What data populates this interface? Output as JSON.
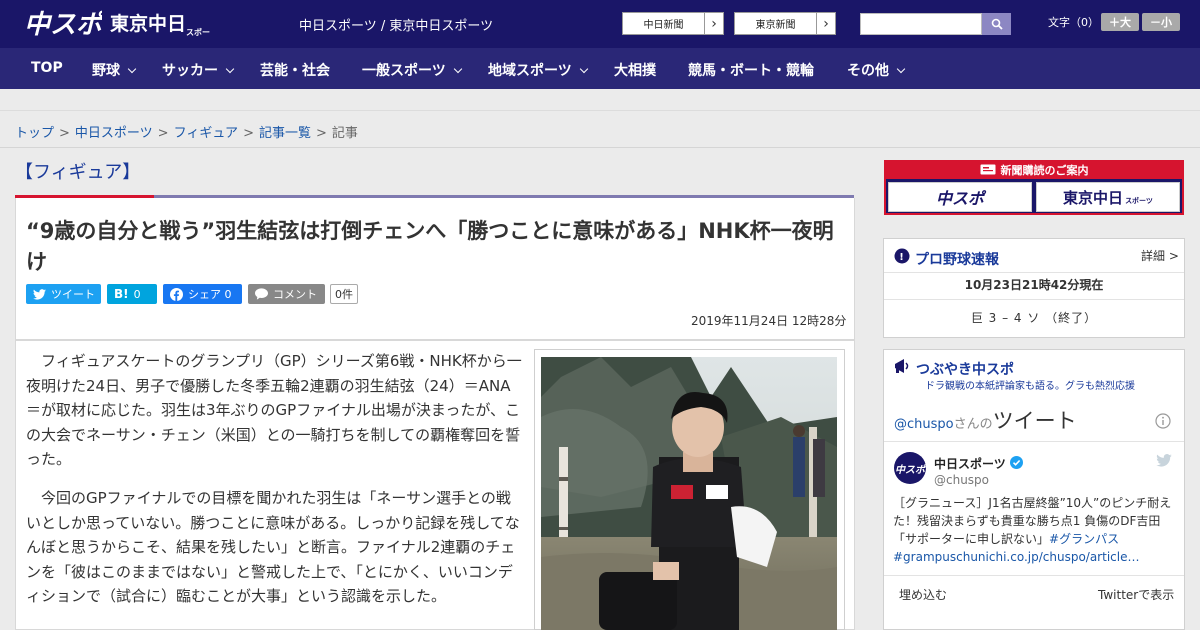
{
  "header": {
    "logo_main": "中スポ",
    "logo_tokyo": "東京中日",
    "logo_tokyo_sub": "スポーツ",
    "site_title": "中日スポーツ / 東京中日スポーツ",
    "paper_links": [
      {
        "label": "中日新聞"
      },
      {
        "label": "東京新聞"
      }
    ],
    "font_size_label": "文字（0）",
    "font_plus": "＋大",
    "font_minus": "－小"
  },
  "nav": {
    "items": [
      {
        "label": "TOP"
      },
      {
        "label": "野球"
      },
      {
        "label": "サッカー"
      },
      {
        "label": "芸能・社会"
      },
      {
        "label": "一般スポーツ"
      },
      {
        "label": "地域スポーツ"
      },
      {
        "label": "大相撲"
      },
      {
        "label": "競馬・ボート・競輪"
      },
      {
        "label": "その他"
      }
    ]
  },
  "breadcrumb": {
    "items": [
      "トップ",
      "中日スポーツ",
      "フィギュア",
      "記事一覧"
    ],
    "current": "記事",
    "separator": ">"
  },
  "article": {
    "category": "【フィギュア】",
    "headline": "“9歳の自分と戦う”羽生結弦は打倒チェンへ「勝つことに意味がある」NHK杯一夜明け",
    "share": {
      "tweet": "ツイート",
      "hatena_count": "0",
      "facebook": "シェア 0",
      "comment": "コメント",
      "comment_count": "0件"
    },
    "date": "2019年11月24日 12時28分",
    "paragraphs": [
      "フィギュアスケートのグランプリ（GP）シリーズ第6戦・NHK杯から一夜明けた24日、男子で優勝した冬季五輪2連覇の羽生結弦（24）＝ANA＝が取材に応じた。羽生は3年ぶりのGPファイナル出場が決まったが、この大会でネーサン・チェン（米国）との一騎打ちを制しての覇権奪回を誓った。",
      "今回のGPファイナルでの目標を聞かれた羽生は「ネーサン選手との戦いとしか思っていない。勝つことに意味がある。しっかり記録を残してなんぼと思うからこそ、結果を残したい」と断言。ファイナル2連覇のチェンを「彼はこのままではない」と警戒した上で、「とにかく、いいコンディションで（試合に）臨むことが大事」という認識を示した。"
    ]
  },
  "sidebar": {
    "ad": {
      "title": "新聞購読のご案内",
      "logo1": "中スポ",
      "logo2": "東京中日",
      "logo2_sub": "スポーツ"
    },
    "baseball": {
      "title": "プロ野球速報",
      "more": "詳細 >",
      "updated": "10月23日21時42分現在",
      "score": "巨 3 – 4 ソ （終了）"
    },
    "twitter": {
      "title": "つぶやき中スポ",
      "subtitle": "ドラ観戦の本紙評論家も語る。グラも熱烈応援",
      "handle_prefix": "@chuspo",
      "handle_suffix": "さんの",
      "tweets_label": "ツイート",
      "account_name": "中日スポーツ",
      "account_handle": "@chuspo",
      "tweet_text": "［グラニュース］J1名古屋終盤”10人”のピンチ耐えた！残留決まらずも貴重な勝ち点1 負傷のDF吉田「サポーターに申し訳ない」",
      "tweet_hashtag": "#グランパス",
      "tweet_link": "#grampuschunichi.co.jp/chuspo/article…",
      "embed_label": "埋め込む",
      "view_on_twitter": "Twitterで表示"
    }
  },
  "colors": {
    "header_bg": "#1a1668",
    "nav_bg": "#2a2777",
    "accent_red": "#d6142f",
    "link_blue": "#1a57a8",
    "twitter_blue": "#1da1f2",
    "facebook_blue": "#1877f2",
    "hatena_blue": "#00a4de"
  }
}
